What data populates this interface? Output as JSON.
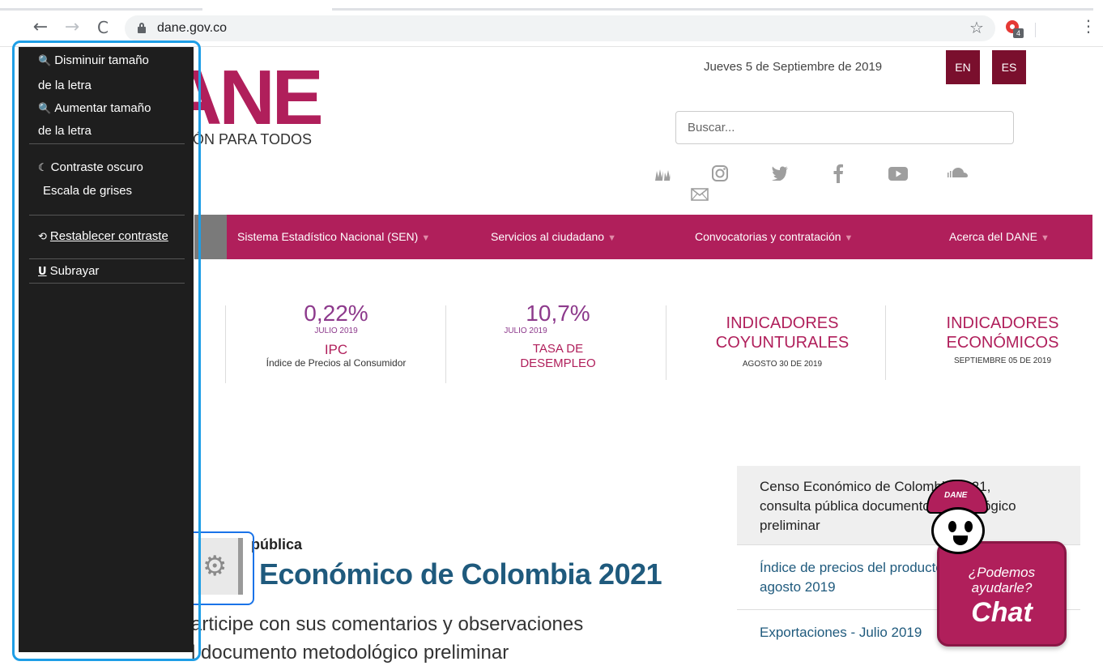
{
  "browser": {
    "url": "dane.gov.co",
    "back_icon": "←",
    "forward_icon": "→",
    "reload_icon": "C",
    "star_icon": "☆",
    "extension_badge": "4",
    "menu_icon": "⋮"
  },
  "header": {
    "logo_text": "ANE",
    "tagline": "ÓN PARA TODOS",
    "date": "Jueves 5 de Septiembre de 2019",
    "lang_en": "EN",
    "lang_es": "ES",
    "search_placeholder": "Buscar..."
  },
  "main_nav": [
    {
      "label": "Sistema Estadístico Nacional (SEN)"
    },
    {
      "label": "Servicios al ciudadano"
    },
    {
      "label": "Convocatorias y contratación"
    },
    {
      "label": "Acerca del DANE"
    }
  ],
  "indicators": [
    {
      "value": "0,22%",
      "date": "JULIO 2019",
      "title": "IPC",
      "subtitle": "Índice de Precios al Consumidor"
    },
    {
      "value": "10,7%",
      "date": "JULIO 2019",
      "title_line1": "TASA DE",
      "title_line2": "DESEMPLEO"
    },
    {
      "title_line1": "INDICADORES",
      "title_line2": "COYUNTURALES",
      "date": "AGOSTO 30 DE 2019"
    },
    {
      "title_line1": "INDICADORES",
      "title_line2": "ECONÓMICOS",
      "date": "SEPTIEMBRE 05 DE 2019"
    }
  ],
  "news": {
    "kicker": "pública",
    "title": "Económico de Colombia 2021",
    "body_line1": "articipe con sus comentarios y observaciones",
    "body_line2": "l documento metodológico preliminar"
  },
  "news_list": [
    {
      "line1": "Censo Económico de Colombia 2021,",
      "line2": "consulta pública documento metodológico",
      "line3": "preliminar"
    },
    {
      "line1": "Índice de precios del productor (IPP)",
      "line2": "agosto 2019"
    },
    {
      "line1": "Exportaciones - Julio 2019"
    }
  ],
  "chat": {
    "question_line1": "¿Podemos",
    "question_line2": "ayudarle?",
    "label": "Chat",
    "mascot_cap": "DANE"
  },
  "accessibility": {
    "decrease_line1": "Disminuir tamaño",
    "decrease_line2": "de la letra",
    "increase_line1": "Aumentar tamaño",
    "increase_line2": "de la letra",
    "dark_contrast": "Contraste oscuro",
    "grayscale": "Escala de grises",
    "reset_contrast": "Restablecer contraste",
    "underline": "Subrayar"
  },
  "colors": {
    "brand_magenta": "#b01f5b",
    "brand_dark": "#7a0f2d",
    "indicator_purple": "#8d3a8c",
    "news_blue": "#1f5a7d",
    "panel_dark": "#1e1e1e",
    "highlight_blue": "#1e9ee6"
  }
}
